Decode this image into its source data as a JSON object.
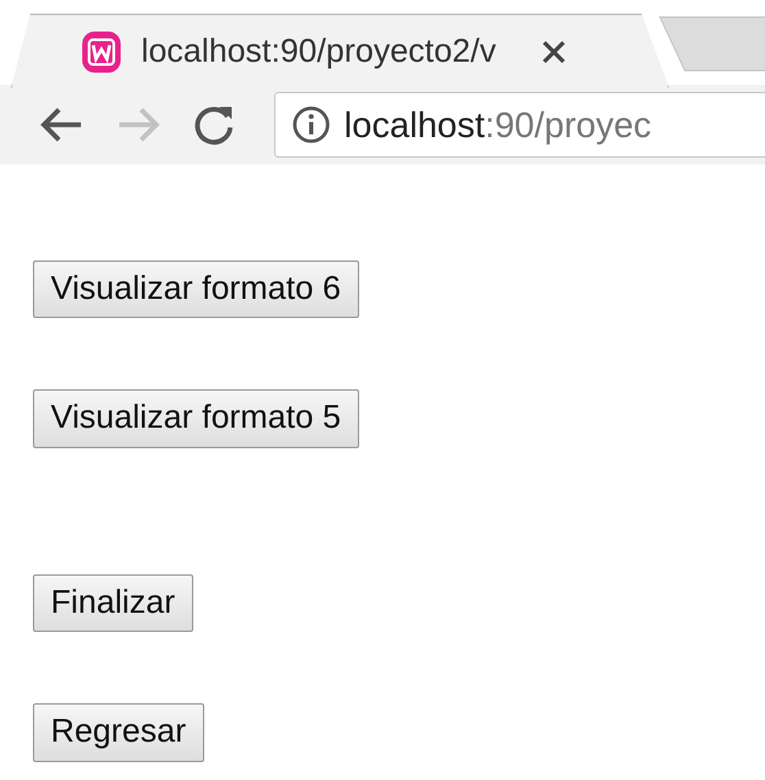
{
  "tab": {
    "title": "localhost:90/proyecto2/v",
    "selected": true
  },
  "toolbar": {
    "back_disabled": false,
    "forward_disabled": true,
    "url_host": "localhost",
    "url_rest": ":90/proyec"
  },
  "buttons": [
    {
      "label": "Visualizar formato 6"
    },
    {
      "label": "Visualizar formato 5"
    },
    {
      "label": "Finalizar"
    },
    {
      "label": "Regresar"
    }
  ]
}
